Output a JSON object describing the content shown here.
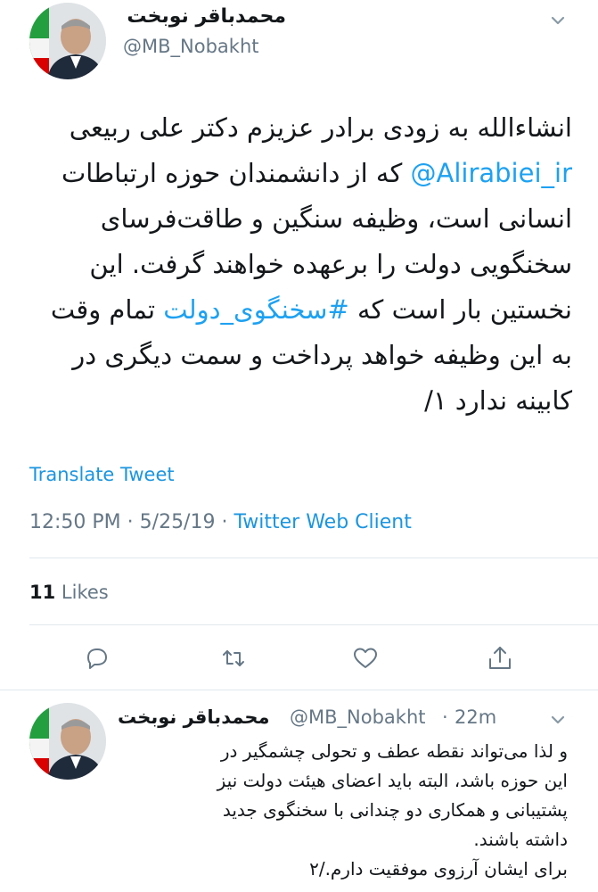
{
  "tweet": {
    "author_name": "محمدباقر نوبخت",
    "author_handle": "@MB_Nobakht",
    "text_lines": [
      "انشاءالله به زودی برادر عزیزم دکتر علی ربیعی",
      {
        "mention": "@Alirabiei_ir",
        "rest": " که از دانشمندان حوزه ارتباطات"
      },
      "انسانی است، وظیفه سنگین و طاقت‌فرسای",
      "سخنگویی دولت را برعهده خواهند گرفت. این",
      {
        "before": "نخستین بار است که ",
        "hashtag": "#سخنگوی_دولت",
        "after": " تمام وقت"
      },
      "به این وظیفه خواهد پرداخت و سمت دیگری در",
      "کابینه ندارد ۱/"
    ],
    "translate_label": "Translate Tweet",
    "time": "12:50 PM",
    "date": "5/25/19",
    "client": "Twitter Web Client",
    "likes_count": "11",
    "likes_label": "Likes"
  },
  "reply": {
    "author_name": "محمدباقر نوبخت",
    "author_handle": "@MB_Nobakht",
    "age": "22m",
    "text_lines": [
      "و لذا می‌تواند نقطه عطف و تحولی چشمگیر در",
      "این حوزه باشد، البته باید اعضای هیئت دولت نیز",
      "پشتیبانی و همکاری دو چندانی با سخنگوی جدید",
      "داشته باشند.",
      "برای ایشان آرزوی موفقیت دارم./۲"
    ]
  },
  "colors": {
    "link": "#1da1f2",
    "secondary": "#657786",
    "text": "#14171a"
  },
  "icons": [
    "chevron-down-icon",
    "reply-icon",
    "retweet-icon",
    "like-icon",
    "share-icon"
  ]
}
